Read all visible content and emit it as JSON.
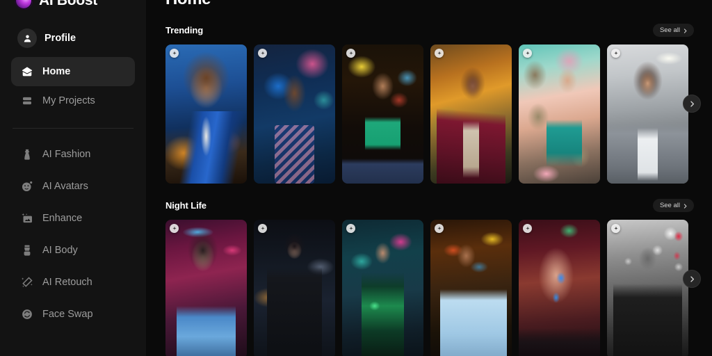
{
  "brand": {
    "name": "AI Boost",
    "logo_icon": "gradient-orb-logo",
    "accent": "#c13be0"
  },
  "sidebar": {
    "profile": {
      "label": "Profile",
      "icon": "person-icon"
    },
    "primary": [
      {
        "label": "Home",
        "icon": "home-icon",
        "active": true
      },
      {
        "label": "My Projects",
        "icon": "layers-icon",
        "active": false
      }
    ],
    "secondary": [
      {
        "label": "AI Fashion",
        "icon": "dress-icon"
      },
      {
        "label": "AI Avatars",
        "icon": "avatar-face-icon"
      },
      {
        "label": "Enhance",
        "icon": "sparkle-image-icon"
      },
      {
        "label": "AI Body",
        "icon": "body-icon"
      },
      {
        "label": "AI Retouch",
        "icon": "magic-wand-icon"
      },
      {
        "label": "Face Swap",
        "icon": "face-swap-icon"
      }
    ]
  },
  "main": {
    "title": "Home",
    "see_all_label": "See all",
    "next_icon": "chevron-right-icon",
    "card_badge_icon": "ai-sparkle-badge-icon",
    "sections": [
      {
        "title": "Trending",
        "cards": [
          {
            "alt": "Woman in blue sequin blazer at dusk window"
          },
          {
            "alt": "Woman in checkered vest at amusement park"
          },
          {
            "alt": "Woman in green crop top on neon city street"
          },
          {
            "alt": "Woman in burgundy coat with autumn hills"
          },
          {
            "alt": "Woman in teal dress surrounded by tabby kittens"
          },
          {
            "alt": "Smiling woman in grey blazer in bright office"
          }
        ]
      },
      {
        "title": "Night Life",
        "cards": [
          {
            "alt": "Woman in blue beaded gown under neon signs"
          },
          {
            "alt": "Person in black suit on city rooftop at night"
          },
          {
            "alt": "Woman in green neon bodysuit on night street"
          },
          {
            "alt": "Man in light blue tee on neon boulevard"
          },
          {
            "alt": "Woman with blue light across face in red room"
          },
          {
            "alt": "Black and white portrait of man in leather jacket"
          }
        ]
      }
    ]
  }
}
